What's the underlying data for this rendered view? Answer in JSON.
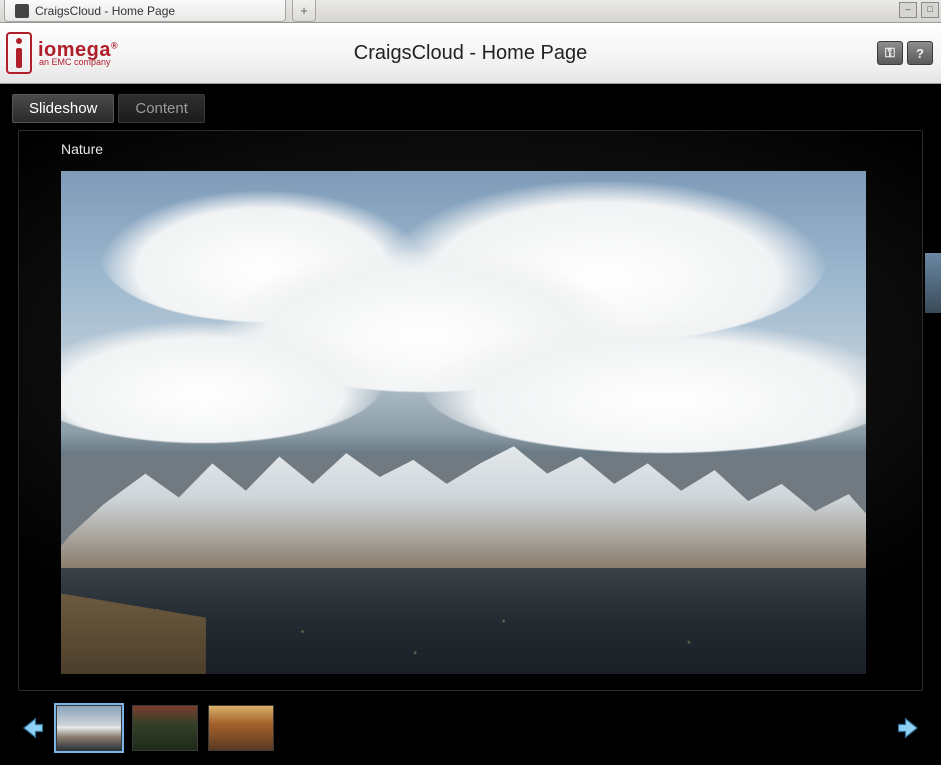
{
  "browser": {
    "tab_title": "CraigsCloud - Home Page",
    "new_tab_glyph": "+",
    "minimize_glyph": "–",
    "maximize_glyph": "□"
  },
  "header": {
    "brand": "iomega",
    "brand_mark": "®",
    "tagline": "an EMC company",
    "page_title": "CraigsCloud - Home Page",
    "key_icon_glyph": "⚿",
    "help_icon_glyph": "?"
  },
  "tabs": {
    "slideshow": "Slideshow",
    "content": "Content"
  },
  "album": {
    "title": "Nature"
  },
  "thumbs": {
    "count": 3,
    "selected_index": 0
  },
  "nav": {
    "prev": "Previous",
    "next": "Next"
  }
}
